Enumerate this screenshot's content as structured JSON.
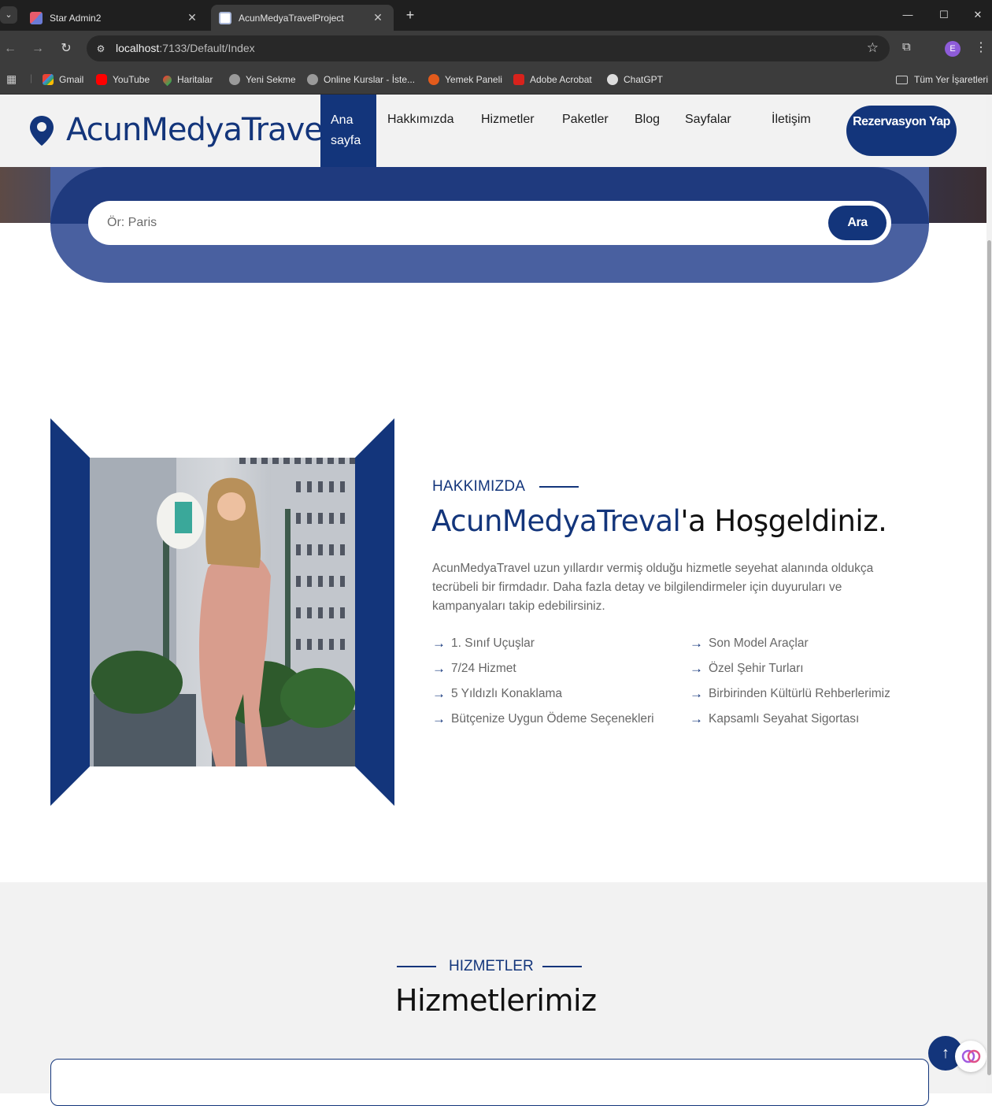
{
  "browser": {
    "tabs": [
      {
        "title": "Star Admin2",
        "active": false
      },
      {
        "title": "AcunMedyaTravelProject",
        "active": true
      }
    ],
    "url_host": "localhost",
    "url_rest": ":7133/Default/Index",
    "profile_initial": "E",
    "bookmarks": [
      {
        "label": "Gmail",
        "icon": "gmail-icon"
      },
      {
        "label": "YouTube",
        "icon": "youtube-icon"
      },
      {
        "label": "Haritalar",
        "icon": "maps-icon"
      },
      {
        "label": "Yeni Sekme",
        "icon": "globe-icon"
      },
      {
        "label": "Online Kurslar - İste...",
        "icon": "globe-icon"
      },
      {
        "label": "Yemek Paneli",
        "icon": "food-icon"
      },
      {
        "label": "Adobe Acrobat",
        "icon": "acrobat-icon"
      },
      {
        "label": "ChatGPT",
        "icon": "chatgpt-icon"
      }
    ],
    "all_bookmarks_label": "Tüm Yer İşaretleri"
  },
  "header": {
    "logo": "AcunMedyaTravel",
    "nav": {
      "home": "Ana sayfa",
      "about": "Hakkımızda",
      "services": "Hizmetler",
      "packages": "Paketler",
      "blog": "Blog",
      "pages": "Sayfalar",
      "contact": "İletişim"
    },
    "reservation": "Rezervasyon Yap"
  },
  "search": {
    "placeholder": "Ör: Paris",
    "button": "Ara"
  },
  "about": {
    "tag": "HAKKIMIZDA",
    "title_brand": "AcunMedyaTreval",
    "title_rest": "'a Hoşgeldiniz.",
    "description": "AcunMedyaTravel uzun yıllardır vermiş olduğu hizmetle seyehat alanında oldukça tecrübeli bir firmdadır. Daha fazla detay ve bilgilendirmeler için duyuruları ve kampanyaları takip edebilirsiniz.",
    "features_left": [
      "1. Sınıf Uçuşlar",
      "7/24 Hizmet",
      "5 Yıldızlı Konaklama",
      "Bütçenize Uygun Ödeme Seçenekleri"
    ],
    "features_right": [
      "Son Model Araçlar",
      "Özel Şehir Turları",
      "Birbirinden Kültürlü Rehberlerimiz",
      "Kapsamlı Seyahat Sigortası"
    ]
  },
  "services": {
    "tag": "HIZMETLER",
    "title": "Hizmetlerimiz"
  },
  "colors": {
    "brand": "#13357b",
    "muted_text": "#676767",
    "section_bg": "#f2f2f2"
  }
}
